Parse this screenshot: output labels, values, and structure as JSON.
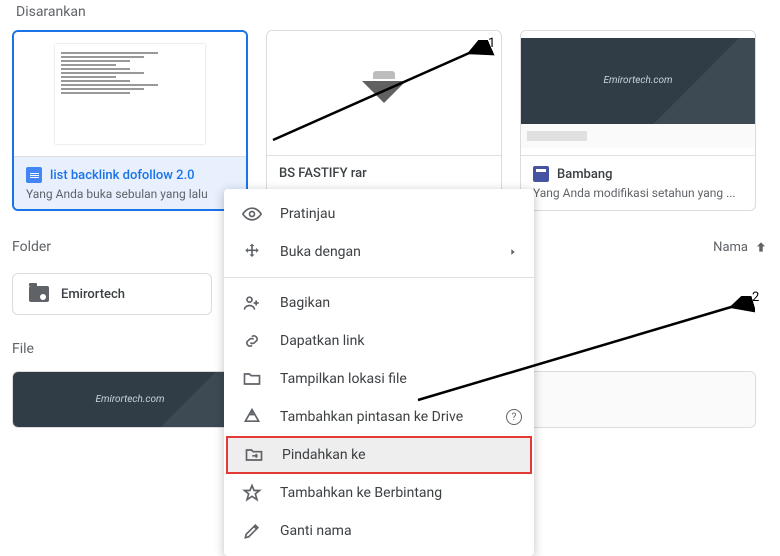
{
  "section_suggested": "Disarankan",
  "cards": [
    {
      "title": "list backlink dofollow 2.0",
      "subtitle": "Yang Anda buka sebulan yang lalu"
    },
    {
      "title": "BS FASTIFY rar",
      "subtitle": ""
    },
    {
      "title": "Bambang",
      "subtitle": "Yang Anda modifikasi setahun yang ...",
      "brand": "Emirortech.com"
    }
  ],
  "folder_section": "Folder",
  "sort_label": "Nama",
  "folders": [
    {
      "name": "Emirortech"
    }
  ],
  "file_section": "File",
  "file_brand": "Emirortech.com",
  "context_menu": {
    "preview": "Pratinjau",
    "open_with": "Buka dengan",
    "share": "Bagikan",
    "get_link": "Dapatkan link",
    "show_location": "Tampilkan lokasi file",
    "add_shortcut": "Tambahkan pintasan ke Drive",
    "move_to": "Pindahkan ke",
    "add_star": "Tambahkan ke Berbintang",
    "rename": "Ganti nama"
  },
  "annotations": {
    "a1": "1",
    "a2": "2"
  }
}
